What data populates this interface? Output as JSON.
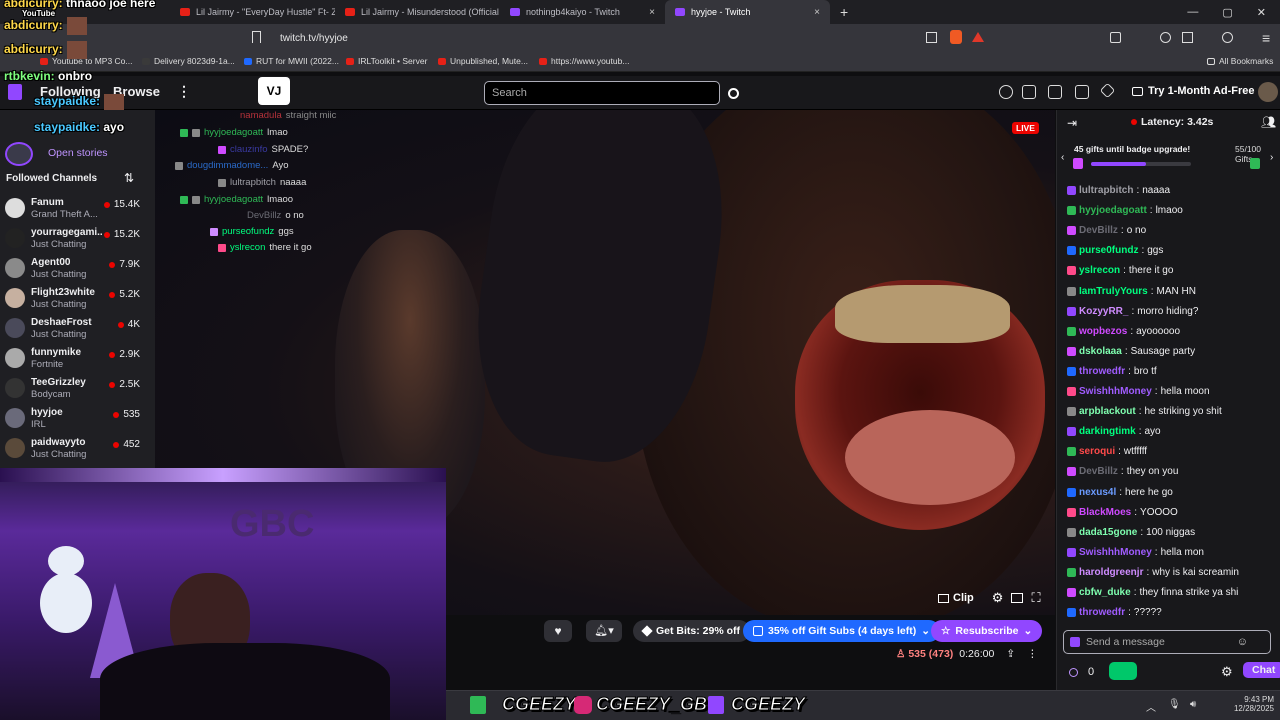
{
  "browser": {
    "tabs": [
      {
        "title": "Lil Jairmy - \"EveryDay Hustle\" Ft- Zill"
      },
      {
        "title": "Lil Jairmy - Misunderstood (Official M"
      },
      {
        "title": "nothingb4kaiyo - Twitch"
      },
      {
        "title": "hyyjoe - Twitch"
      }
    ],
    "new_tab": "+",
    "url": "twitch.tv/hyyjoe",
    "bookmarks": [
      "Youtube to MP3 Co...",
      "Delivery 8023d9-1a...",
      "RUT for MWII (2022...",
      "IRLToolkit • Server",
      "Unpublished, Mute...",
      "https://www.youtub..."
    ],
    "all_bookmarks": "All Bookmarks",
    "window_controls": [
      "—",
      "▢",
      "✕"
    ]
  },
  "stream_overlay_top": {
    "line1_user": "abdicurry:",
    "line1_text": "thnaoo joe here",
    "line1_sub": "YouTube",
    "line2_user": "abdicurry:",
    "line3_user": "abdicurry:",
    "line4_user": "rtbkevin:",
    "line4_text": "onbro",
    "line5_user": "staypaidke:",
    "line6_user": "staypaidke:",
    "line6_text": "ayo"
  },
  "twitch": {
    "following": "Following",
    "browse": "Browse",
    "search_placeholder": "Search",
    "ad_free": "Try 1-Month Ad-Free"
  },
  "sidebar": {
    "open_stories": "Open stories",
    "followed_header": "Followed Channels",
    "channels": [
      {
        "name": "Fanum",
        "game": "Grand Theft A...",
        "viewers": "15.4K"
      },
      {
        "name": "yourragegami...",
        "game": "Just Chatting",
        "viewers": "15.2K"
      },
      {
        "name": "Agent00",
        "game": "Just Chatting",
        "viewers": "7.9K"
      },
      {
        "name": "Flight23white",
        "game": "Just Chatting",
        "viewers": "5.2K"
      },
      {
        "name": "DeshaeFrost",
        "game": "Just Chatting",
        "viewers": "4K"
      },
      {
        "name": "funnymike",
        "game": "Fortnite",
        "viewers": "2.9K"
      },
      {
        "name": "TeeGrizzley",
        "game": "Bodycam",
        "viewers": "2.5K"
      },
      {
        "name": "hyyjoe",
        "game": "IRL",
        "viewers": "535"
      },
      {
        "name": "paidwayyto",
        "game": "Just Chatting",
        "viewers": "452"
      }
    ]
  },
  "video_overlay_chat": [
    {
      "user": "namadula",
      "text": "straight miic"
    },
    {
      "user": "hyyjoedagoatt",
      "text": "lmao"
    },
    {
      "user": "clauzinfo",
      "text": "SPADE?"
    },
    {
      "user": "dougdimmadome...",
      "text": "Ayo"
    },
    {
      "user": "lultrapbitch",
      "text": "naaaa"
    },
    {
      "user": "hyyjoedagoatt",
      "text": "lmaoo"
    },
    {
      "user": "DevBillz",
      "text": "o no"
    },
    {
      "user": "purseofundz",
      "text": "ggs"
    },
    {
      "user": "yslrecon",
      "text": "there it go"
    }
  ],
  "player": {
    "live": "LIVE",
    "clip": "Clip",
    "get_bits": "Get Bits: 29% off",
    "gift_subs": "35% off Gift Subs (4 days left)",
    "resubscribe": "Resubscribe",
    "viewers": "535 (473)",
    "uptime": "0:26:00"
  },
  "chat": {
    "latency": "Latency: 3.42s",
    "gift_progress": "45 gifts until badge upgrade!",
    "gift_count": "55/100 Gifts",
    "gift_fill": 0.55,
    "messages": [
      {
        "user": "lultrapbitch",
        "text": "naaaa",
        "color": "#9f9fa6"
      },
      {
        "user": "hyyjoedagoatt",
        "text": "lmaoo",
        "color": "#2fb956"
      },
      {
        "user": "DevBillz",
        "text": "o no",
        "color": "#6b6b74"
      },
      {
        "user": "purse0fundz",
        "text": "ggs",
        "color": "#00ff7f"
      },
      {
        "user": "yslrecon",
        "text": "there it go",
        "color": "#00ff7f"
      },
      {
        "user": "IamTrulyYours",
        "text": "MAN HN",
        "color": "#00ff7f"
      },
      {
        "user": "KozyyRR_",
        "text": "morro hiding?",
        "color": "#cf8cff"
      },
      {
        "user": "wopbezos",
        "text": "ayoooooo",
        "color": "#cf4aff"
      },
      {
        "user": "dskolaaa",
        "text": "Sausage party",
        "color": "#7fffb0"
      },
      {
        "user": "throwedfr",
        "text": "bro tf",
        "color": "#a05cff"
      },
      {
        "user": "SwishhhMoney",
        "text": "hella moon",
        "color": "#a05cff"
      },
      {
        "user": "arpblackout",
        "text": "he striking yo shit",
        "color": "#7fffb0"
      },
      {
        "user": "darkingtimk",
        "text": "ayo",
        "color": "#00ff7f"
      },
      {
        "user": "seroqui",
        "text": "wtfffff",
        "color": "#ff4a4a"
      },
      {
        "user": "DevBillz",
        "text": "they on you",
        "color": "#6b6b74"
      },
      {
        "user": "nexus4l",
        "text": "here he go",
        "color": "#6b9bff"
      },
      {
        "user": "BlackMoes",
        "text": "YOOOO",
        "color": "#cf4aff"
      },
      {
        "user": "dada15gone",
        "text": "100 niggas",
        "color": "#7fffb0"
      },
      {
        "user": "SwishhhMoney",
        "text": "hella mon",
        "color": "#a05cff"
      },
      {
        "user": "haroldgreenjr",
        "text": "why is kai screamin",
        "color": "#cf8cff"
      },
      {
        "user": "cbfw_duke",
        "text": "they finna strike ya shi",
        "color": "#7fffb0"
      },
      {
        "user": "throwedfr",
        "text": "?????",
        "color": "#a05cff"
      }
    ],
    "input_placeholder": "Send a message",
    "points": "0",
    "chat_button": "Chat"
  },
  "taskbar": {
    "brand1": "CGEEZY",
    "brand2": "CGEEZY_GBC",
    "brand3": "CGEEZY",
    "time": "9:43 PM",
    "date": "12/28/2025"
  },
  "colors": {
    "twitch_purple": "#9147ff",
    "live_red": "#eb0400",
    "gift_blue": "#1f69ff"
  }
}
